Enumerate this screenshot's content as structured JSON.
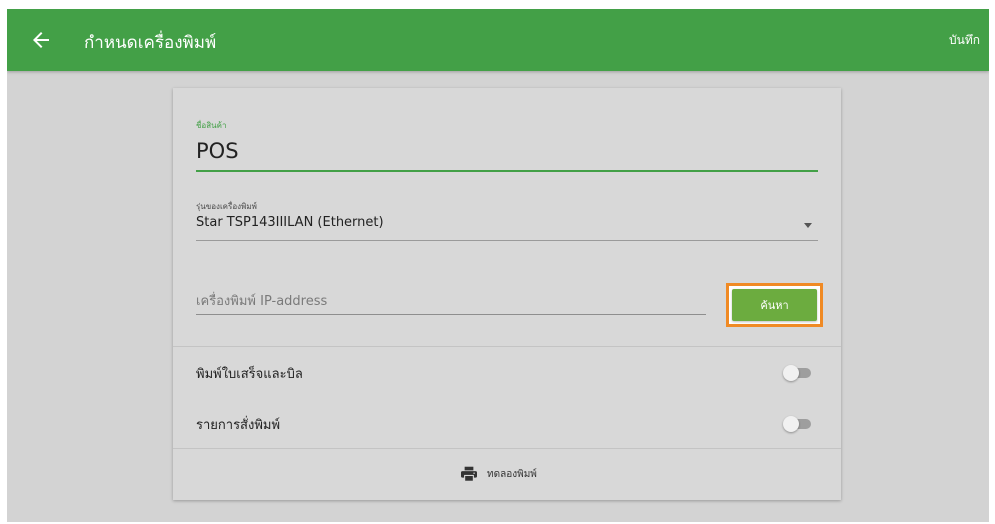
{
  "appbar": {
    "title": "กำหนดเครื่องพิมพ์",
    "save_label": "บันทึก",
    "back_icon": "arrow-left-icon",
    "color": "#43a047"
  },
  "form": {
    "product_name": {
      "label": "ชื่อสินค้า",
      "value": "POS"
    },
    "printer_model": {
      "label": "รุ่นของเครื่องพิมพ์",
      "value": "Star TSP143IIILAN (Ethernet)",
      "icon": "caret-down-icon"
    },
    "ip_address": {
      "placeholder": "เครื่องพิมพ์ IP-address",
      "value": ""
    },
    "search_button": {
      "label": "ค้นหา",
      "color": "#6cac3f",
      "highlight_color": "#f08a24"
    },
    "toggles": [
      {
        "label": "พิมพ์ใบเสร็จและบิล",
        "on": false
      },
      {
        "label": "รายการสั่งพิมพ์",
        "on": false
      }
    ],
    "test_print": {
      "label": "ทดลองพิมพ์",
      "icon": "printer-icon"
    }
  }
}
